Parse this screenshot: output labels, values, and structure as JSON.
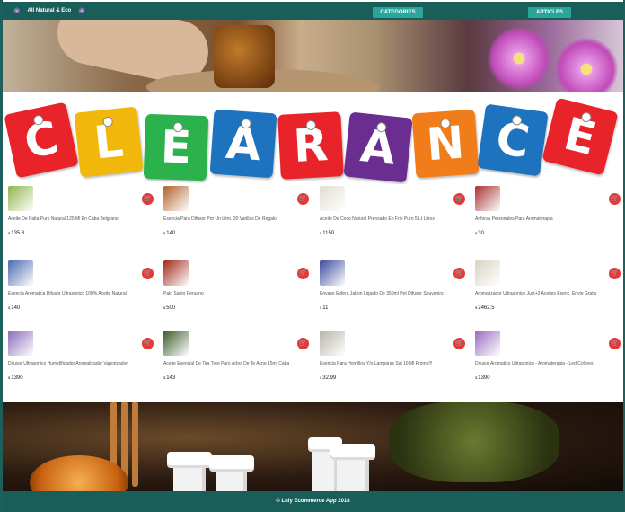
{
  "header": {
    "brand": "All Natural & Eco",
    "nav": {
      "categories_label": "CATEGORIES",
      "articles_label": "ARTICLES"
    }
  },
  "banner": {
    "letters": [
      "C",
      "L",
      "E",
      "A",
      "R",
      "A",
      "N",
      "C",
      "E"
    ]
  },
  "products": [
    {
      "title": "Aceite De Palta Puro Natural 125 Ml En Caba Belgrano",
      "price": "135.3",
      "currency": "$",
      "thumb_color": "#8fb54a"
    },
    {
      "title": "Esencia Para Difusor Por Un Litro. 30 Varillas De Regalo",
      "price": "140",
      "currency": "$",
      "thumb_color": "#b0602a"
    },
    {
      "title": "Aceite De Coco Natural Prensado En Frio Puro 5 Lt Litros",
      "price": "1150",
      "currency": "$",
      "thumb_color": "#e0ddd0"
    },
    {
      "title": "Anforas Personales Para Aromaterapia",
      "price": "30",
      "currency": "$",
      "thumb_color": "#a83030"
    },
    {
      "title": "Esencia Aromatica Difusor Ultrasonico 100% Aceite Natural",
      "price": "140",
      "currency": "$",
      "thumb_color": "#4a6ab0"
    },
    {
      "title": "Palo Santo Peruano",
      "price": "500",
      "currency": "$",
      "thumb_color": "#a02818"
    },
    {
      "title": "Envase Esfera Jabon Liquido De 350ml Pet Difusor Souvenirs",
      "price": "11",
      "currency": "$",
      "thumb_color": "#3a4aa0"
    },
    {
      "title": "Aromatizador Ultrasonico Just+3 Aceites Esenc. Envio Gratis",
      "price": "2462.5",
      "currency": "$",
      "thumb_color": "#d8d2c2"
    },
    {
      "title": "Difusor Ultrasonico Humidificador Aromatizador Vaporizador",
      "price": "1390",
      "currency": "$",
      "thumb_color": "#8a6ab8"
    },
    {
      "title": "Aceite Esencial De Tea Tree Puro Árbol De Te Acne 15ml Caba",
      "price": "143",
      "currency": "$",
      "thumb_color": "#3a5a2a"
    },
    {
      "title": "Esencia Para Hornillos Y/o Lamparas Sal 10 Ml Promo!!!",
      "price": "32.99",
      "currency": "$",
      "thumb_color": "#b8b4a8"
    },
    {
      "title": "Difusor Aromatico Ultrasonico - Aromaterapia - Led Colores",
      "price": "1390",
      "currency": "$",
      "thumb_color": "#9a6ac0"
    }
  ],
  "footer": {
    "text": "© Luly Ecommerce App 2018"
  },
  "colors": {
    "nav_bar": "#1a5e59",
    "nav_button": "#2aa59a",
    "cart_badge": "#e53935",
    "tag_colors": [
      "#e8232a",
      "#f2b70b",
      "#2bb24c",
      "#1e73be",
      "#e8232a",
      "#6a2e91",
      "#f07d1a",
      "#1e73be",
      "#e8232a"
    ]
  },
  "icons": {
    "brand": "lotus-icon",
    "cart": "cart-icon"
  }
}
